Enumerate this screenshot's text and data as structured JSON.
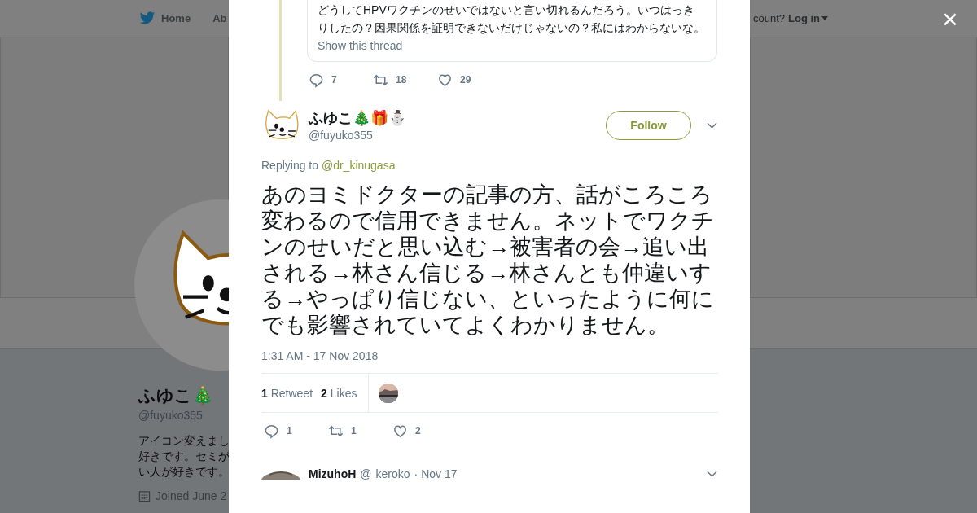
{
  "background_page": {
    "nav": {
      "home": "Home",
      "about": "Ab",
      "account_prompt": "count?",
      "login": "Log in"
    },
    "profile": {
      "name": "ふゆこ🎄",
      "handle": "@fuyuko355",
      "bio_lines": [
        "アイコン変えまし",
        "好きです。セミが",
        "い人が好きです。"
      ],
      "joined": "Joined June 2"
    }
  },
  "close_label": "×",
  "dialog": {
    "quoted_tweet": {
      "text_lines": [
        "どうしてHPVワクチンのせいではないと言い切れるんだろう。いつはっき",
        "りしたの？因果関係を証明できないだけじゃないの？私にはわからないな。"
      ],
      "thread_link": "Show this thread",
      "actions": [
        {
          "kind": "reply",
          "count": "7"
        },
        {
          "kind": "retweet",
          "count": "18"
        },
        {
          "kind": "like",
          "count": "29"
        }
      ]
    },
    "tweet": {
      "name": "ふゆこ🎄🎁⛄",
      "handle": "@fuyuko355",
      "follow": "Follow",
      "replying_prefix": "Replying to",
      "replying_to": "@dr_kinugasa",
      "text": "あのヨミドクターの記事の方、話がころころ変わるので信用できません。ネットでワクチンのせいだと思い込む→被害者の会→追い出される→林さん信じる→林さんとも仲違いする→やっぱり信じない、といったように何にでも影響されていてよくわかりません。",
      "timestamp": "1:31 AM - 17 Nov 2018",
      "stats": [
        {
          "count": "1",
          "label": "Retweet"
        },
        {
          "count": "2",
          "label": "Likes"
        }
      ],
      "actions": [
        {
          "kind": "reply",
          "count": "1"
        },
        {
          "kind": "retweet",
          "count": "1"
        },
        {
          "kind": "like",
          "count": "2"
        }
      ]
    },
    "reply": {
      "name": "MizuhoH",
      "at": "@",
      "handle": "keroko",
      "date": "· Nov 17"
    }
  }
}
